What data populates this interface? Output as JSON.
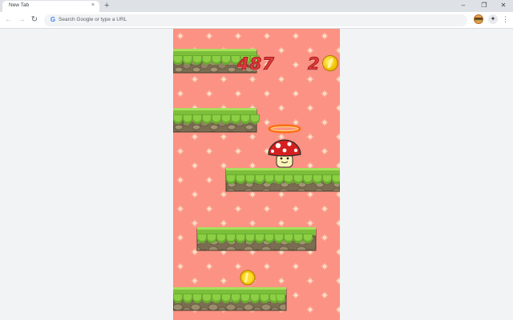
{
  "browser": {
    "tab_title": "New Tab",
    "tab_close_glyph": "×",
    "new_tab_glyph": "+",
    "window_controls": [
      "–",
      "❐",
      "✕"
    ],
    "omnibox_placeholder": "Search Google or type a URL",
    "nav": {
      "back_glyph": "←",
      "forward_glyph": "→",
      "reload_glyph": "↻"
    },
    "extensions": [
      "burger-extension-icon",
      "puzzle-icon"
    ],
    "menu_glyph": "⋮"
  },
  "game": {
    "score": "487",
    "coins_collected": "2",
    "background_color": "#fb9283",
    "pattern_color": "#fde1c7",
    "grass_color": "#7cbf3a",
    "dirt_color": "#8a7b5f",
    "player": "red-mushroom",
    "halo_color": "#ff7a1a"
  }
}
